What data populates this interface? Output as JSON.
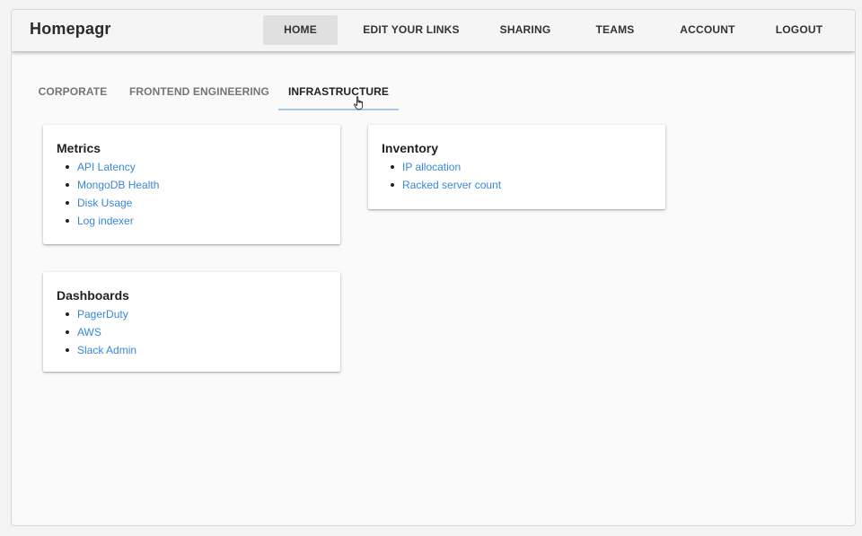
{
  "app": {
    "title": "Homepagr"
  },
  "nav": {
    "items": [
      {
        "label": "HOME",
        "active": true
      },
      {
        "label": "EDIT YOUR LINKS",
        "active": false
      },
      {
        "label": "SHARING",
        "active": false
      },
      {
        "label": "TEAMS",
        "active": false
      },
      {
        "label": "ACCOUNT",
        "active": false
      },
      {
        "label": "LOGOUT",
        "active": false
      }
    ]
  },
  "tabs": {
    "items": [
      {
        "label": "CORPORATE",
        "active": false
      },
      {
        "label": "FRONTEND ENGINEERING",
        "active": false
      },
      {
        "label": "INFRASTRUCTURE",
        "active": true
      }
    ]
  },
  "cards": {
    "metrics": {
      "title": "Metrics",
      "links": [
        "API Latency",
        "MongoDB Health",
        "Disk Usage",
        "Log indexer"
      ]
    },
    "inventory": {
      "title": "Inventory",
      "links": [
        "IP allocation",
        "Racked server count"
      ]
    },
    "dashboards": {
      "title": "Dashboards",
      "links": [
        "PagerDuty",
        "AWS",
        "Slack Admin"
      ]
    }
  },
  "colors": {
    "link": "#3a86d6",
    "tab_indicator": "#a8c6ec",
    "nav_active_bg": "#e0e0e0"
  },
  "icons": {
    "cursor": "hand-pointer-icon"
  }
}
